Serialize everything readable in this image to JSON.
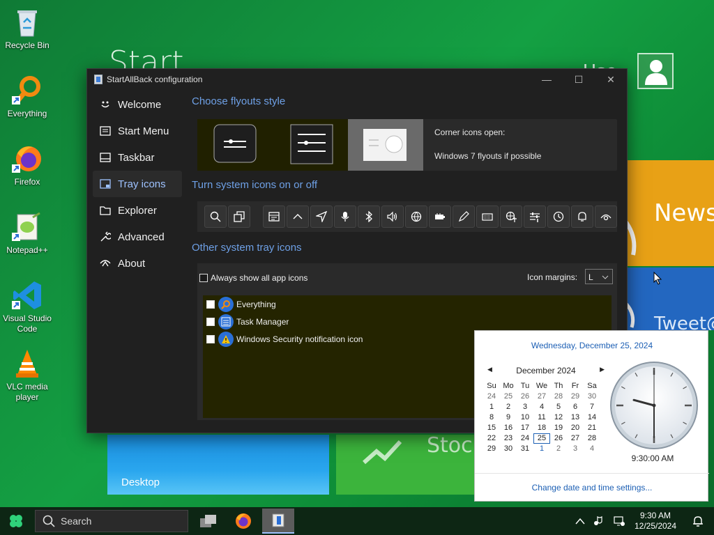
{
  "start_screen": {
    "title": "Start",
    "user_name": "Use",
    "tiles": {
      "news": "News",
      "twitter": "Tweet@",
      "desktop": "Desktop",
      "stocks": "Stock"
    }
  },
  "desktop_icons": [
    {
      "label": "Recycle Bin",
      "icon": "recycle-bin-icon"
    },
    {
      "label": "Everything",
      "icon": "everything-icon"
    },
    {
      "label": "Firefox",
      "icon": "firefox-icon"
    },
    {
      "label": "Notepad++",
      "icon": "notepadpp-icon"
    },
    {
      "label": "Visual Studio Code",
      "icon": "vscode-icon"
    },
    {
      "label": "VLC media player",
      "icon": "vlc-icon"
    }
  ],
  "window": {
    "title": "StartAllBack configuration",
    "nav": [
      {
        "label": "Welcome",
        "icon": "smile-icon"
      },
      {
        "label": "Start Menu",
        "icon": "start-menu-icon"
      },
      {
        "label": "Taskbar",
        "icon": "taskbar-icon"
      },
      {
        "label": "Tray icons",
        "icon": "tray-icon",
        "active": true
      },
      {
        "label": "Explorer",
        "icon": "folder-icon"
      },
      {
        "label": "Advanced",
        "icon": "wrench-icon"
      },
      {
        "label": "About",
        "icon": "about-icon"
      }
    ],
    "flyouts_title": "Choose flyouts style",
    "flyouts_options": [
      "Corner icons open:",
      "Windows 7 flyouts if possible"
    ],
    "system_icons_title": "Turn system icons on or off",
    "system_icons": [
      "search-icon",
      "task-view-icon",
      "news-icon",
      "chevron-up-icon",
      "location-icon",
      "microphone-icon",
      "bluetooth-icon",
      "volume-icon",
      "globe-icon",
      "battery-icon",
      "pen-icon",
      "keyboard-icon",
      "language-icon",
      "settings-sliders-icon",
      "clock-icon",
      "bell-icon",
      "eye-icon"
    ],
    "other_tray_title": "Other system tray icons",
    "always_show_label": "Always show all app icons",
    "icon_margins_label": "Icon margins:",
    "icon_margins_value": "L",
    "tray_items": [
      {
        "label": "Everything",
        "icon": "everything-icon"
      },
      {
        "label": "Task Manager",
        "icon": "task-manager-icon"
      },
      {
        "label": "Windows Security notification icon",
        "icon": "security-warning-icon"
      }
    ]
  },
  "clock_flyout": {
    "long_date": "Wednesday, December 25, 2024",
    "month_label": "December 2024",
    "weekdays": [
      "Su",
      "Mo",
      "Tu",
      "We",
      "Th",
      "Fr",
      "Sa"
    ],
    "weeks": [
      [
        "24",
        "25",
        "26",
        "27",
        "28",
        "29",
        "30"
      ],
      [
        "1",
        "2",
        "3",
        "4",
        "5",
        "6",
        "7"
      ],
      [
        "8",
        "9",
        "10",
        "11",
        "12",
        "13",
        "14"
      ],
      [
        "15",
        "16",
        "17",
        "18",
        "19",
        "20",
        "21"
      ],
      [
        "22",
        "23",
        "24",
        "25",
        "26",
        "27",
        "28"
      ],
      [
        "29",
        "30",
        "31",
        "1",
        "2",
        "3",
        "4"
      ]
    ],
    "today": "25",
    "time": "9:30:00 AM",
    "analog_time": {
      "hours": 9,
      "minutes": 30,
      "seconds": 0
    },
    "settings_link": "Change date and time settings..."
  },
  "taskbar": {
    "search_placeholder": "Search",
    "apps": [
      "task-view-icon",
      "firefox-icon",
      "startallback-icon"
    ],
    "time": "9:30 AM",
    "date": "12/25/2024"
  },
  "colors": {
    "accent": "#6ea0e6",
    "desktop_green": "#14a043",
    "window_bg": "#202020",
    "link_blue": "#1c5fb4"
  }
}
